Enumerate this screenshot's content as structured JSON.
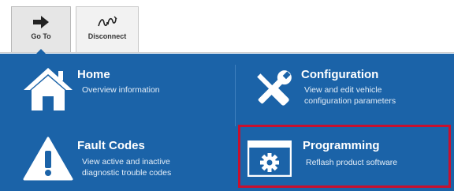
{
  "toolbar": {
    "goto_label": "Go To",
    "disconnect_label": "Disconnect"
  },
  "menu": {
    "home": {
      "title": "Home",
      "description": "Overview information",
      "icon": "home-icon"
    },
    "configuration": {
      "title": "Configuration",
      "description_line1": "View and edit vehicle",
      "description_line2": "configuration parameters",
      "icon": "wrench-screwdriver-icon"
    },
    "fault_codes": {
      "title": "Fault Codes",
      "description_line1": "View active and inactive",
      "description_line2": "diagnostic trouble codes",
      "icon": "warning-icon"
    },
    "programming": {
      "title": "Programming",
      "description": "Reflash product software",
      "icon": "window-gear-icon",
      "highlighted": true
    }
  },
  "colors": {
    "panel": "#1b63a8",
    "highlight": "#c8102e",
    "text": "#ffffff"
  }
}
